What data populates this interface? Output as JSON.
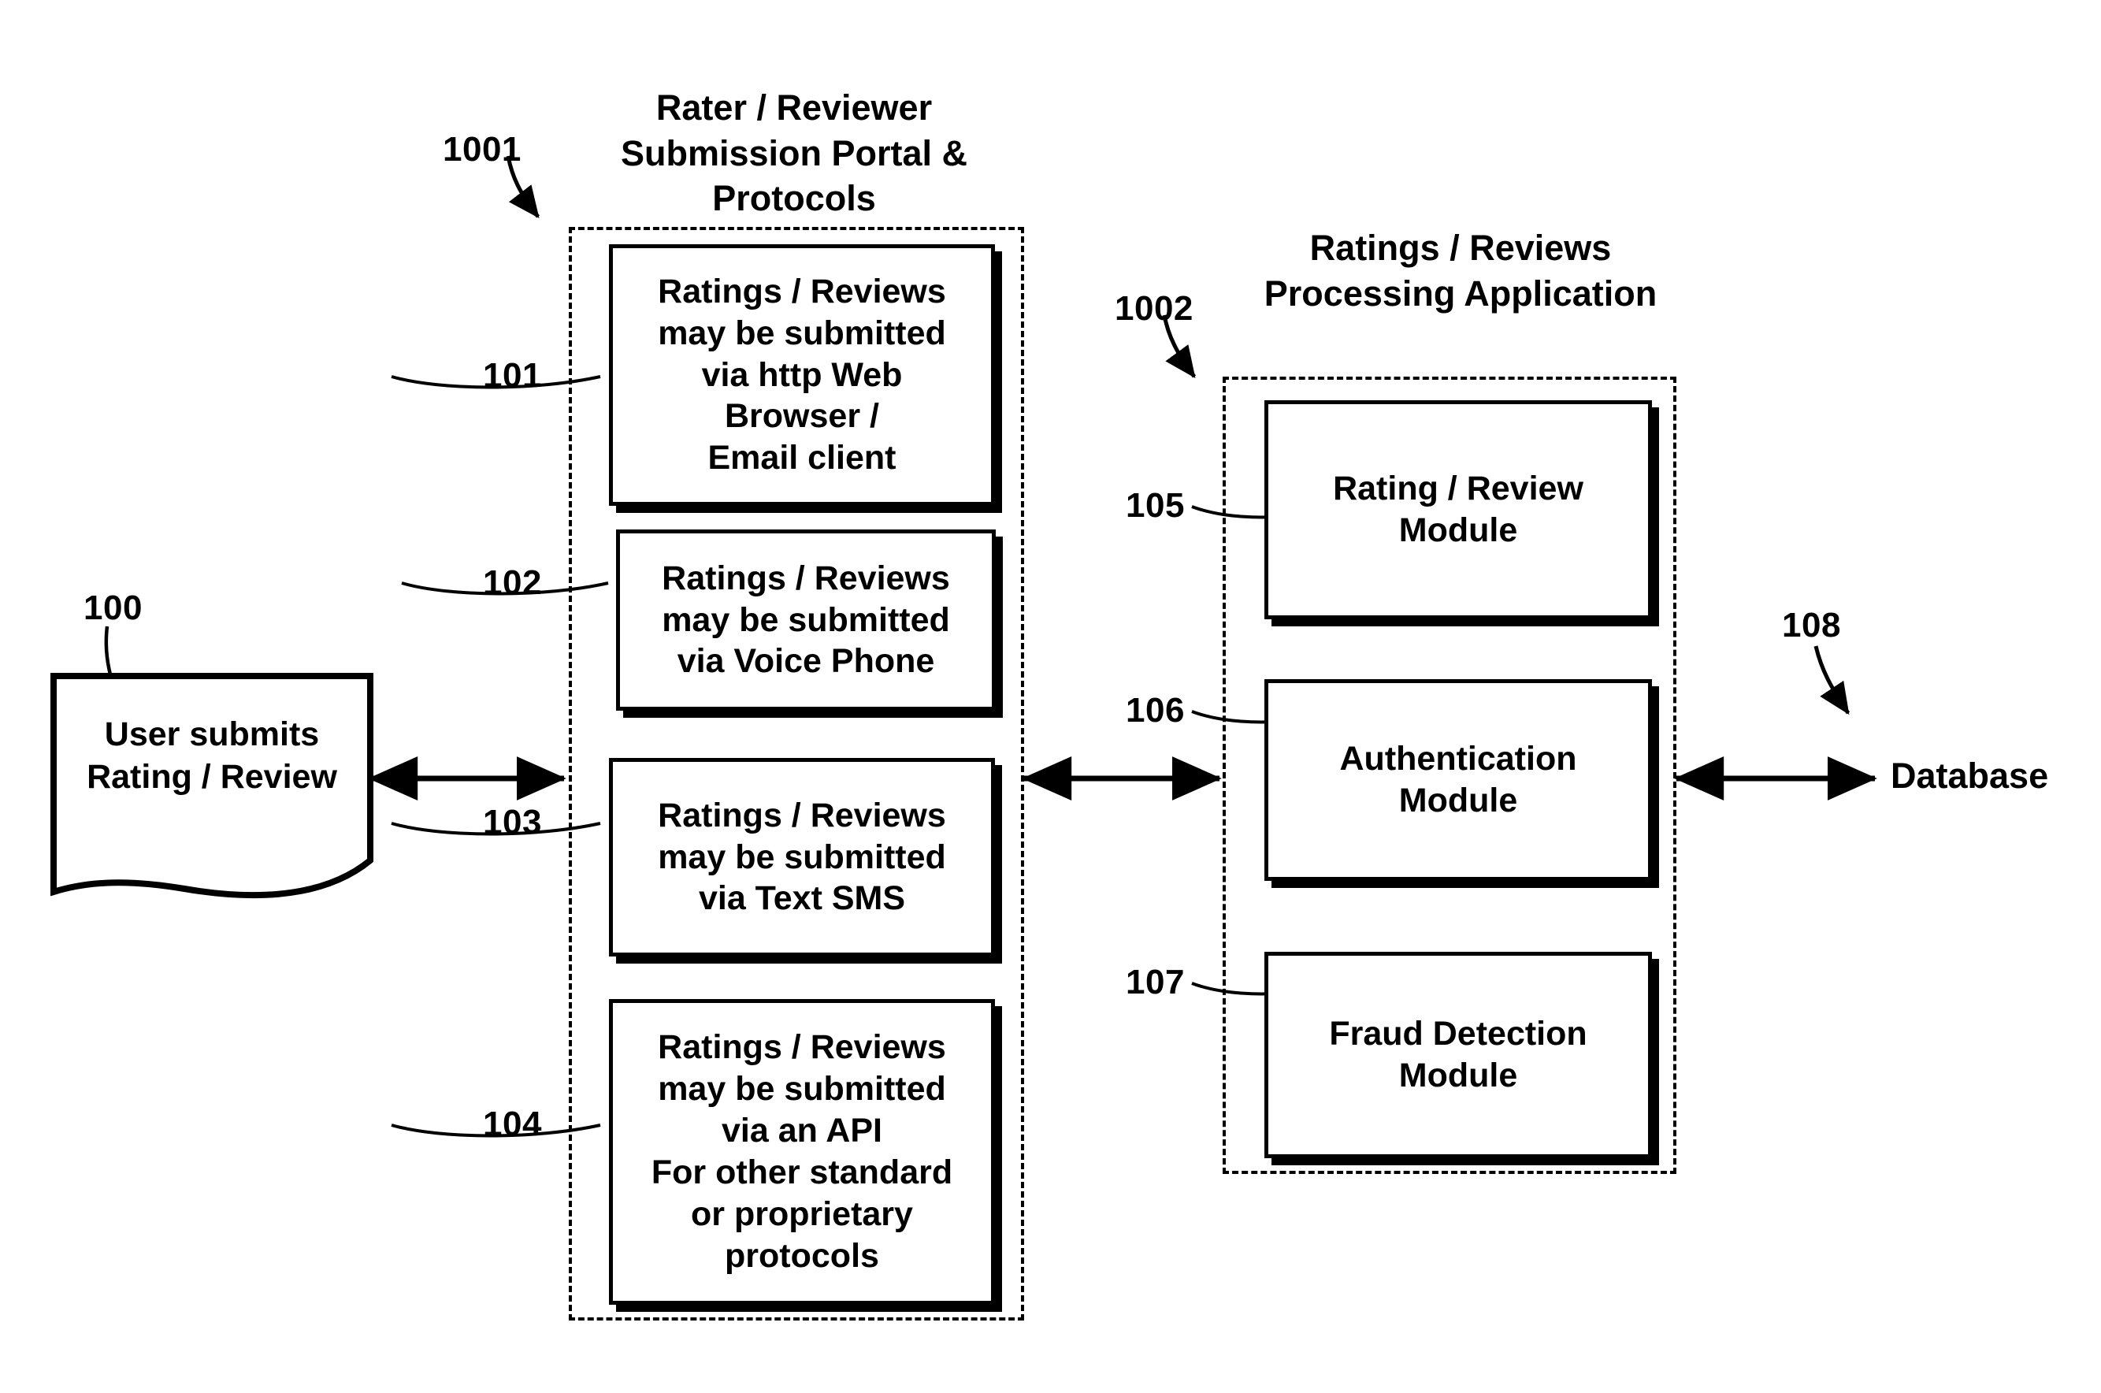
{
  "figure": {
    "title": "Ratings / Reviews submission and processing system block diagram",
    "background_color": "#ffffff",
    "line_color": "#000000"
  },
  "source_node": {
    "ref": "100",
    "label": "User submits\nRating / Review",
    "shape": "document"
  },
  "submission_portal": {
    "ref": "1001",
    "title": "Rater / Reviewer\nSubmission Portal &\nProtocols",
    "boxes": [
      {
        "ref": "101",
        "label": "Ratings / Reviews\nmay be submitted\nvia http Web\nBrowser /\nEmail client"
      },
      {
        "ref": "102",
        "label": "Ratings / Reviews\nmay be submitted\nvia Voice Phone"
      },
      {
        "ref": "103",
        "label": "Ratings / Reviews\nmay be submitted\nvia Text SMS"
      },
      {
        "ref": "104",
        "label": "Ratings / Reviews\nmay be submitted\nvia an API\nFor other standard\nor proprietary\nprotocols"
      }
    ]
  },
  "processing_application": {
    "ref": "1002",
    "title": "Ratings / Reviews\nProcessing Application",
    "boxes": [
      {
        "ref": "105",
        "label": "Rating / Review\nModule"
      },
      {
        "ref": "106",
        "label": "Authentication\nModule"
      },
      {
        "ref": "107",
        "label": "Fraud Detection\nModule"
      }
    ]
  },
  "database_node": {
    "ref": "108",
    "label": "Database",
    "shape": "plain-text"
  },
  "connectors": [
    {
      "name": "user-to-portal",
      "type": "double-headed-arrow",
      "from": "100",
      "to": "1001"
    },
    {
      "name": "portal-to-processing",
      "type": "double-headed-arrow",
      "from": "1001",
      "to": "1002"
    },
    {
      "name": "processing-to-database",
      "type": "double-headed-arrow",
      "from": "1002",
      "to": "108"
    }
  ]
}
